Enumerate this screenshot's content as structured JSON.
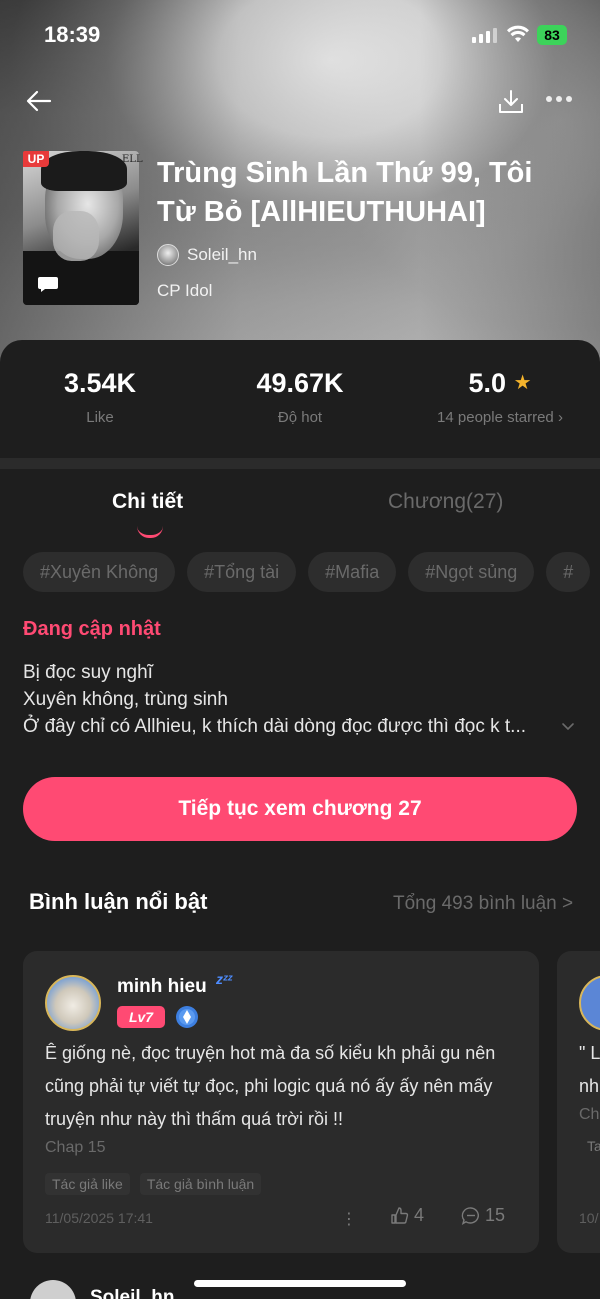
{
  "status_bar": {
    "time": "18:39",
    "battery": "83"
  },
  "book": {
    "badge": "UP",
    "cover_mark": "ELL",
    "title": "Trùng Sinh Lần Thứ 99, Tôi Từ Bỏ [AllHIEUTHUHAI]",
    "author": "Soleil_hn",
    "category": "CP Idol"
  },
  "stats": {
    "likes": {
      "value": "3.54K",
      "label": "Like"
    },
    "hot": {
      "value": "49.67K",
      "label": "Độ hot"
    },
    "rating": {
      "value": "5.0",
      "label": "14 people starred ›"
    }
  },
  "tabs": {
    "detail": "Chi tiết",
    "chapters": "Chương(27)"
  },
  "tags": [
    "#Xuyên Không",
    "#Tổng tài",
    "#Mafia",
    "#Ngọt sủng",
    "#"
  ],
  "status_text": "Đang cập nhật",
  "description": [
    "Bị đọc suy nghĩ",
    "Xuyên không, trùng sinh",
    "Ở đây chỉ có Allhieu, k thích dài dòng đọc được thì đọc k t..."
  ],
  "cta": "Tiếp tục xem chương 27",
  "comments": {
    "heading": "Bình luận nổi bật",
    "total": "Tổng 493 bình luận >",
    "items": [
      {
        "user": "minh hieu",
        "zzz": "zᶻᶻ",
        "level": "Lv7",
        "text": "Ê giống nè, đọc truyện hot mà đa số kiểu kh phải gu nên cũng phải tự viết tự đọc, phi logic quá nó ấy ấy nên mấy truyện như này thì thấm quá trời rồi !!",
        "chapter": "Chap 15",
        "tags": [
          "Tác giả like",
          "Tác giả bình luận"
        ],
        "date": "11/05/2025 17:41",
        "likes": "4",
        "replies": "15"
      },
      {
        "text_lines": [
          "\" L",
          "nh",
          "Ch"
        ],
        "chapter": "",
        "tag": "Ta",
        "date": "10/"
      }
    ]
  },
  "next_comment_user": "Soleil_hn"
}
